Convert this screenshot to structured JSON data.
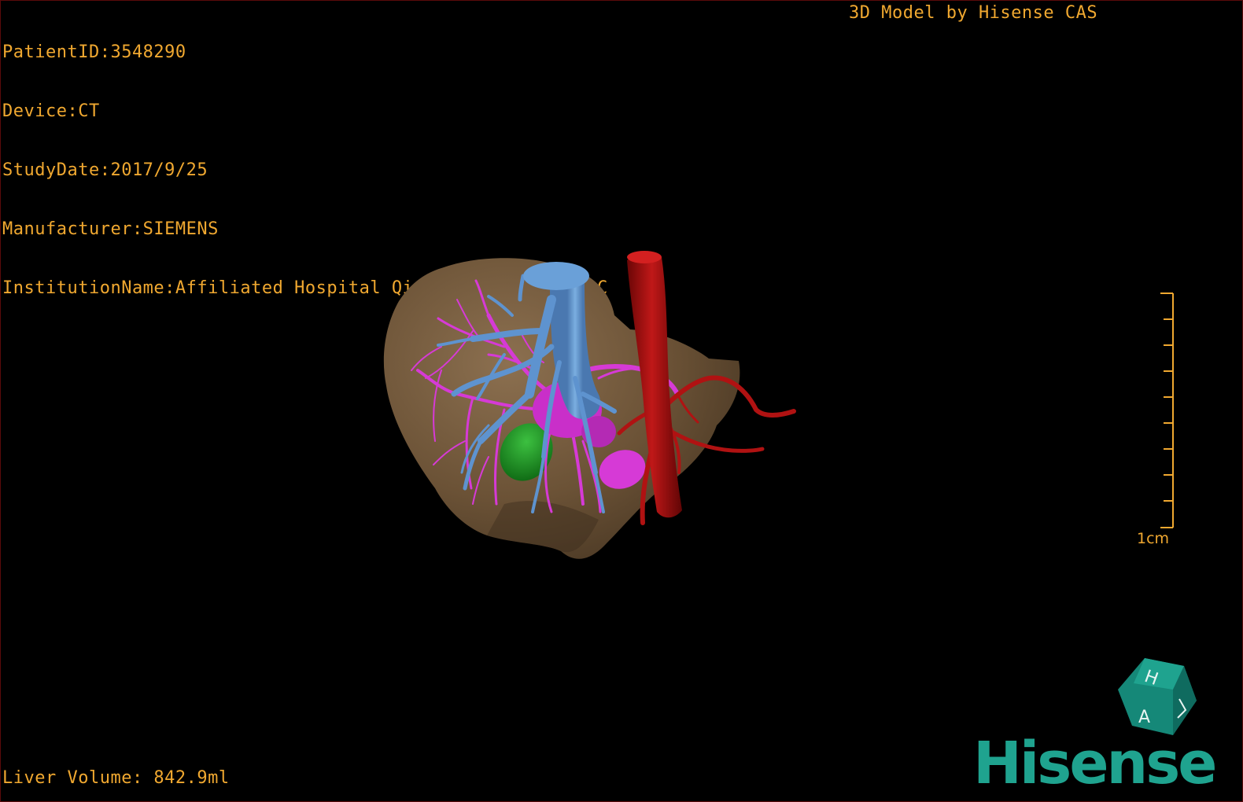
{
  "header": {
    "patient_id": "PatientID:3548290",
    "device": "Device:CT",
    "study_date": "StudyDate:2017/9/25",
    "manufacturer": "Manufacturer:SIEMENS",
    "institution": "InstitutionName:Affiliated Hospital Qingdao University-C",
    "brand_caption": "3D Model by Hisense CAS"
  },
  "footer": {
    "liver_volume": "Liver Volume: 842.9ml"
  },
  "scale_bar": {
    "label": "1cm"
  },
  "logo": {
    "wordmark": "Hisense",
    "cube_letters": [
      "H",
      "A"
    ]
  },
  "colors": {
    "overlay_text": "#f0a830",
    "liver": "#7a6040",
    "portal_vein": "#5e93cf",
    "hepatic_vein": "#d63ad6",
    "aorta": "#b01212",
    "gallbladder": "#1c9a24",
    "logo": "#1fa38f"
  }
}
